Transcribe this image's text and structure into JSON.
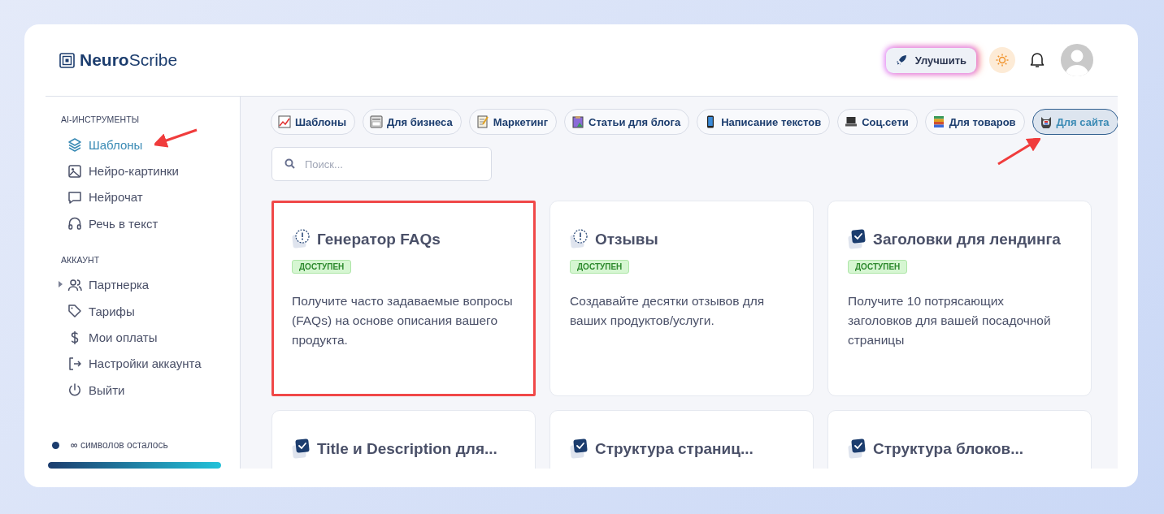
{
  "header": {
    "logo": {
      "bold": "Neuro",
      "light": "Scribe"
    },
    "upgrade_button": "Улучшить"
  },
  "sidebar": {
    "sections": [
      {
        "title": "AI-ИНСТРУМЕНТЫ",
        "items": [
          {
            "label": "Шаблоны",
            "selected": true,
            "annotated": true
          },
          {
            "label": "Нейро-картинки",
            "selected": false,
            "annotated": false
          },
          {
            "label": "Нейрочат",
            "selected": false,
            "annotated": false
          },
          {
            "label": "Речь в текст",
            "selected": false,
            "annotated": false
          }
        ]
      },
      {
        "title": "АККАУНТ",
        "items": [
          {
            "label": "Партнерка",
            "selected": false,
            "annotated": false,
            "expanded": false
          },
          {
            "label": "Тарифы",
            "selected": false,
            "annotated": false
          },
          {
            "label": "Мои оплаты",
            "selected": false,
            "annotated": false
          },
          {
            "label": "Настройки аккаунта",
            "selected": false,
            "annotated": false
          },
          {
            "label": "Выйти",
            "selected": false,
            "annotated": false
          }
        ]
      }
    ],
    "credits": {
      "text": "**∞** символов осталось",
      "level": 1
    }
  },
  "categories": [
    {
      "label": "Шаблоны",
      "selected": false,
      "annotated": false
    },
    {
      "label": "Для бизнеса",
      "selected": false,
      "annotated": false
    },
    {
      "label": "Маркетинг",
      "selected": false,
      "annotated": false
    },
    {
      "label": "Статьи для блога",
      "selected": false,
      "annotated": false
    },
    {
      "label": "Написание текстов",
      "selected": false,
      "annotated": false
    },
    {
      "label": "Соц.сети",
      "selected": false,
      "annotated": false
    },
    {
      "label": "Для товаров",
      "selected": false,
      "annotated": false
    },
    {
      "label": "Для сайта",
      "selected": true,
      "annotated": true
    }
  ],
  "search": {
    "placeholder": "Поиск..."
  },
  "templates": [
    {
      "kind": "alert",
      "title": "Генератор FAQs",
      "badge": "ДОСТУПЕН",
      "description": "Получите часто задаваемые вопросы (FAQs) на основе описания вашего продукта.",
      "highlighted": true
    },
    {
      "kind": "alert",
      "title": "Отзывы",
      "badge": "ДОСТУПЕН",
      "description": "Создавайте десятки отзывов для ваших продуктов/услуги.",
      "highlighted": false
    },
    {
      "kind": "check",
      "title": "Заголовки для лендинга",
      "badge": "ДОСТУПЕН",
      "description": "Получите 10 потрясающих заголовков для вашей посадочной страницы",
      "highlighted": false
    },
    {
      "kind": "check",
      "title": "Title и Description для...",
      "highlighted": false
    },
    {
      "kind": "check",
      "title": "Структура страниц...",
      "highlighted": false
    },
    {
      "kind": "check",
      "title": "Структура блоков...",
      "highlighted": false
    }
  ]
}
